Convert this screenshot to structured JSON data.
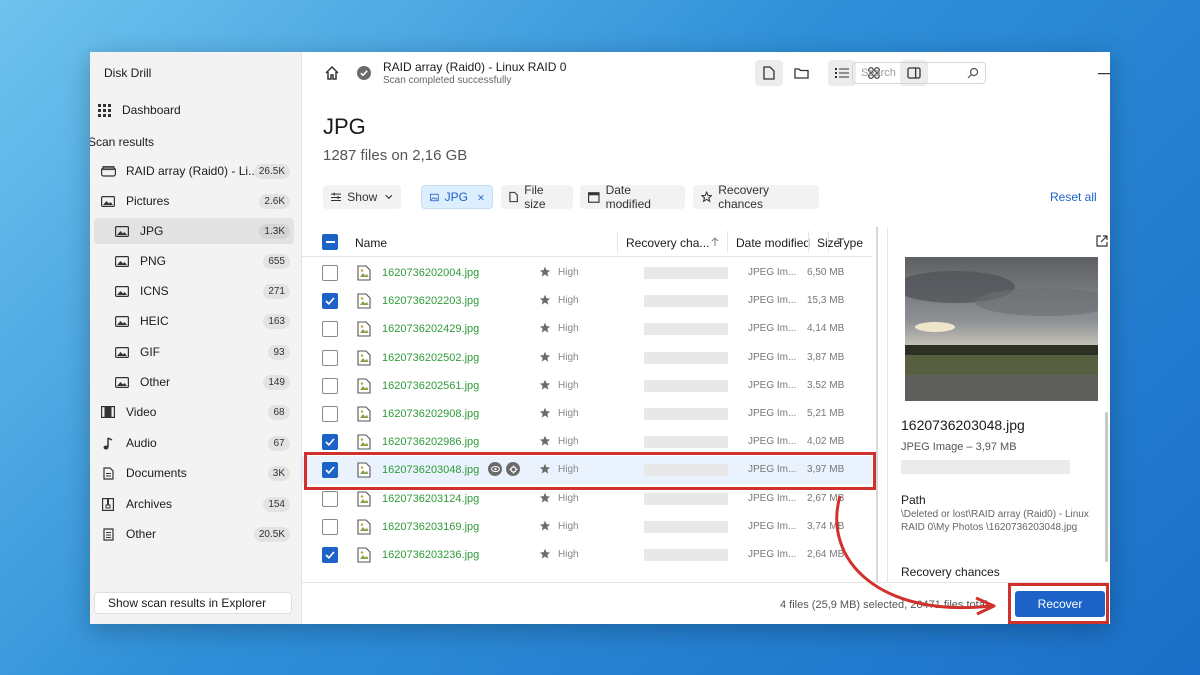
{
  "app": {
    "title": "Disk Drill"
  },
  "sidebar": {
    "dashboard_label": "Dashboard",
    "section_label": "Scan results",
    "items": [
      {
        "label": "RAID array (Raid0) - Li...",
        "count": "26.5K",
        "icon": "drive-icon"
      },
      {
        "label": "Pictures",
        "count": "2.6K",
        "icon": "image-icon"
      },
      {
        "label": "JPG",
        "count": "1.3K",
        "icon": "image-icon",
        "active": true
      },
      {
        "label": "PNG",
        "count": "655",
        "icon": "image-icon"
      },
      {
        "label": "ICNS",
        "count": "271",
        "icon": "image-icon"
      },
      {
        "label": "HEIC",
        "count": "163",
        "icon": "image-icon"
      },
      {
        "label": "GIF",
        "count": "93",
        "icon": "image-icon"
      },
      {
        "label": "Other",
        "count": "149",
        "icon": "image-icon"
      },
      {
        "label": "Video",
        "count": "68",
        "icon": "video-icon"
      },
      {
        "label": "Audio",
        "count": "67",
        "icon": "music-icon"
      },
      {
        "label": "Documents",
        "count": "3K",
        "icon": "document-icon"
      },
      {
        "label": "Archives",
        "count": "154",
        "icon": "archive-icon"
      },
      {
        "label": "Other",
        "count": "20.5K",
        "icon": "file-icon"
      }
    ],
    "footer_button": "Show scan results in Explorer"
  },
  "header": {
    "title": "RAID array (Raid0) - Linux RAID 0",
    "subtitle": "Scan completed successfully",
    "search_placeholder": "Search"
  },
  "page": {
    "title": "JPG",
    "subtitle": "1287 files on 2,16 GB"
  },
  "filters": {
    "show": "Show",
    "jpg": "JPG",
    "file_size": "File size",
    "date_modified": "Date modified",
    "recovery_chances": "Recovery chances",
    "reset": "Reset all"
  },
  "table": {
    "columns": {
      "name": "Name",
      "recovery": "Recovery cha...",
      "date": "Date modified",
      "type": "Type",
      "size": "Size"
    },
    "rows": [
      {
        "name": "1620736202004.jpg",
        "chance": "High",
        "type": "JPEG Im...",
        "size": "6,50 MB",
        "checked": false
      },
      {
        "name": "1620736202203.jpg",
        "chance": "High",
        "type": "JPEG Im...",
        "size": "15,3 MB",
        "checked": true
      },
      {
        "name": "1620736202429.jpg",
        "chance": "High",
        "type": "JPEG Im...",
        "size": "4,14 MB",
        "checked": false
      },
      {
        "name": "1620736202502.jpg",
        "chance": "High",
        "type": "JPEG Im...",
        "size": "3,87 MB",
        "checked": false
      },
      {
        "name": "1620736202561.jpg",
        "chance": "High",
        "type": "JPEG Im...",
        "size": "3,52 MB",
        "checked": false
      },
      {
        "name": "1620736202908.jpg",
        "chance": "High",
        "type": "JPEG Im...",
        "size": "5,21 MB",
        "checked": false
      },
      {
        "name": "1620736202986.jpg",
        "chance": "High",
        "type": "JPEG Im...",
        "size": "4,02 MB",
        "checked": true
      },
      {
        "name": "1620736203048.jpg",
        "chance": "High",
        "type": "JPEG Im...",
        "size": "3,97 MB",
        "checked": true,
        "selected": true
      },
      {
        "name": "1620736203124.jpg",
        "chance": "High",
        "type": "JPEG Im...",
        "size": "2,67 MB",
        "checked": false
      },
      {
        "name": "1620736203169.jpg",
        "chance": "High",
        "type": "JPEG Im...",
        "size": "3,74 MB",
        "checked": false
      },
      {
        "name": "1620736203236.jpg",
        "chance": "High",
        "type": "JPEG Im...",
        "size": "2,64 MB",
        "checked": true
      }
    ]
  },
  "preview": {
    "filename": "1620736203048.jpg",
    "type": "JPEG Image – 3,97 MB",
    "path_heading": "Path",
    "path": "\\Deleted or lost\\RAID array (Raid0) - Linux RAID 0\\My Photos \\1620736203048.jpg",
    "recovery_heading": "Recovery chances"
  },
  "footer": {
    "summary": "4 files (25,9 MB) selected, 26471 files total",
    "recover_button": "Recover"
  },
  "colors": {
    "accent": "#1d63c7",
    "filename_green": "#2f9b3a",
    "highlight_red": "#d0312d"
  }
}
